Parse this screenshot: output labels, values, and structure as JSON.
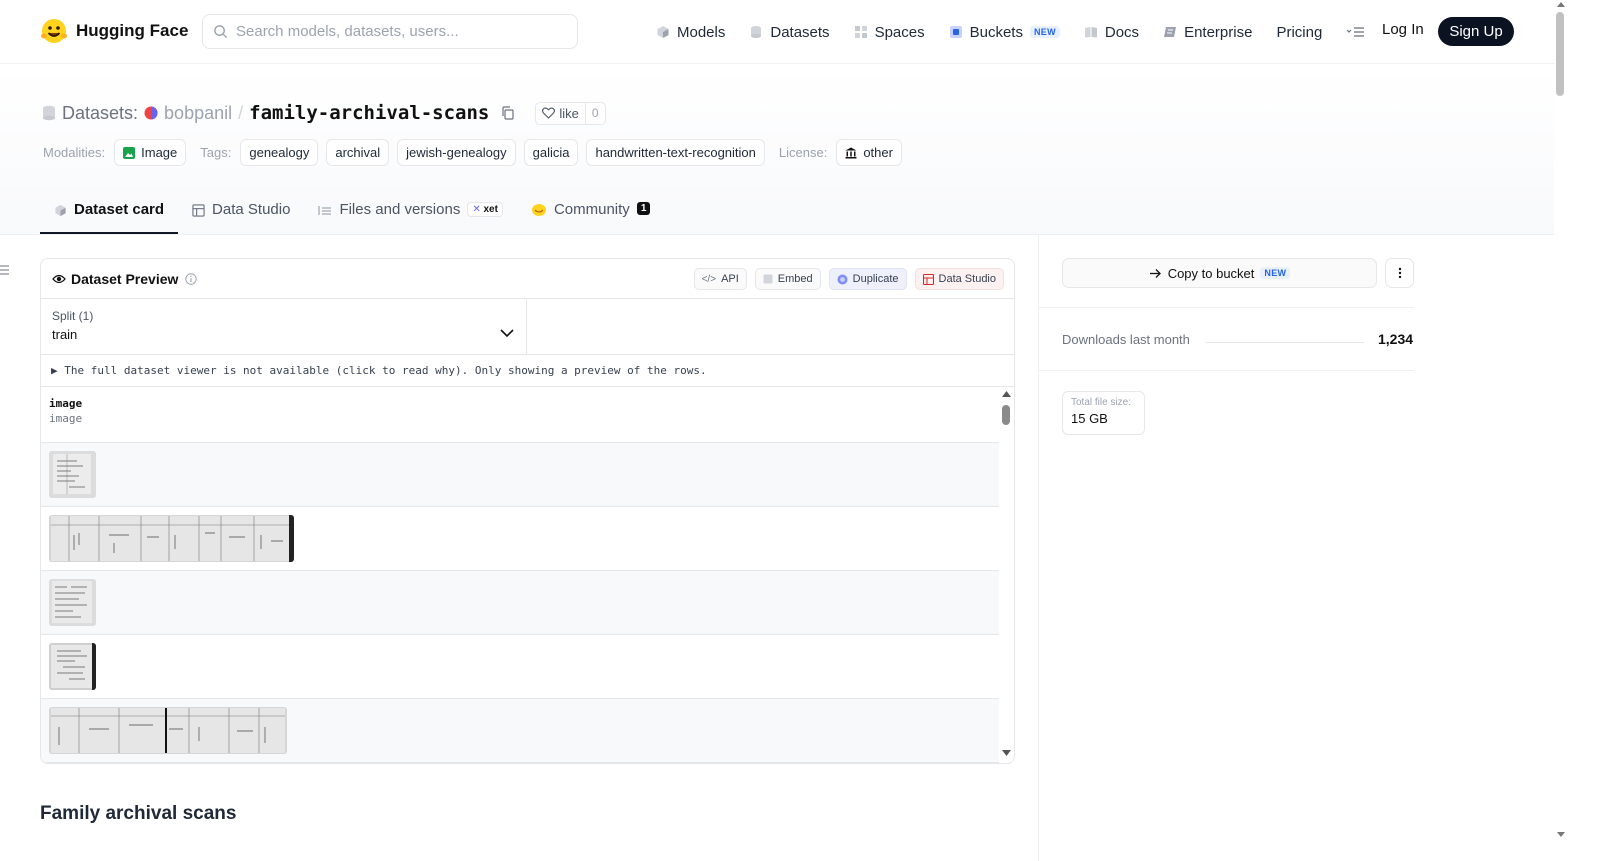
{
  "header": {
    "brand": "Hugging Face",
    "search_placeholder": "Search models, datasets, users...",
    "nav": [
      {
        "label": "Models",
        "icon": "cube-icon"
      },
      {
        "label": "Datasets",
        "icon": "database-icon"
      },
      {
        "label": "Spaces",
        "icon": "grid-icon"
      },
      {
        "label": "Buckets",
        "icon": "bucket-icon",
        "badge": "NEW"
      },
      {
        "label": "Docs",
        "icon": "book-icon"
      },
      {
        "label": "Enterprise",
        "icon": "enterprise-icon"
      },
      {
        "label": "Pricing"
      }
    ],
    "login": "Log In",
    "signup": "Sign Up"
  },
  "repo": {
    "prefix": "Datasets:",
    "owner": "bobpanil",
    "separator": "/",
    "name": "family-archival-scans",
    "like_label": "like",
    "like_count": "0"
  },
  "meta": {
    "modalities_label": "Modalities:",
    "modality": "Image",
    "tags_label": "Tags:",
    "tags": [
      "genealogy",
      "archival",
      "jewish-genealogy",
      "galicia",
      "handwritten-text-recognition"
    ],
    "license_label": "License:",
    "license": "other"
  },
  "tabs": [
    {
      "label": "Dataset card",
      "active": true
    },
    {
      "label": "Data Studio"
    },
    {
      "label": "Files and versions",
      "badge": "xet"
    },
    {
      "label": "Community",
      "count": "1"
    }
  ],
  "preview": {
    "title": "Dataset Preview",
    "buttons": {
      "api": "API",
      "embed": "Embed",
      "duplicate": "Duplicate",
      "data_studio": "Data Studio"
    },
    "split_label": "Split (1)",
    "split_value": "train",
    "notice": "The full dataset viewer is not available (click to read why). Only showing a preview of the rows.",
    "column_name": "image",
    "column_type": "image"
  },
  "section_heading": "Family archival scans",
  "sidebar": {
    "copy_label": "Copy to bucket",
    "copy_badge": "NEW",
    "downloads_label": "Downloads last month",
    "downloads_value": "1,234",
    "size_label": "Total file size:",
    "size_value": "15 GB"
  },
  "colors": {
    "signup_bg": "#0b1222",
    "new_badge": "#2563eb",
    "community_badge": "#111111"
  }
}
